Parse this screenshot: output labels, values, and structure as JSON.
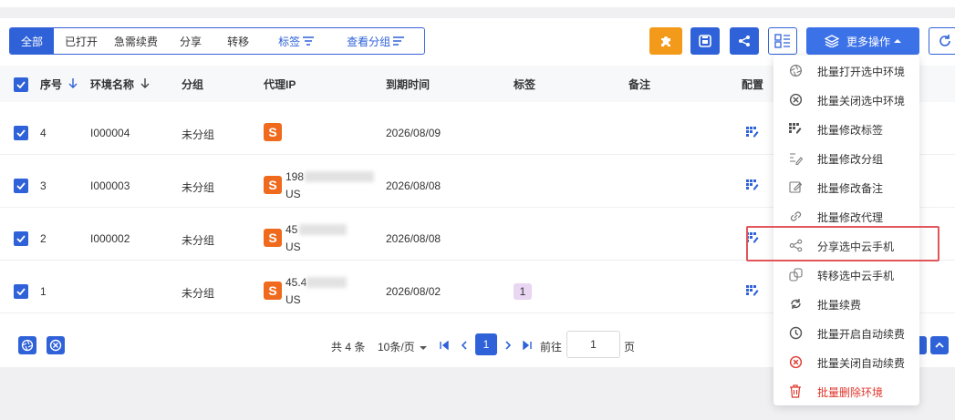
{
  "tabs": [
    {
      "label": "全部",
      "active": true
    },
    {
      "label": "已打开"
    },
    {
      "label": "急需续费"
    },
    {
      "label": "分享"
    },
    {
      "label": "转移"
    },
    {
      "label": "标签"
    },
    {
      "label": "查看分组"
    }
  ],
  "toolbar": {
    "more_label": "更多操作",
    "buttons": [
      "puzzle-icon",
      "save-icon",
      "share-icon",
      "layout-icon",
      "refresh-icon"
    ]
  },
  "table": {
    "columns": [
      "序号",
      "环境名称",
      "分组",
      "代理IP",
      "到期时间",
      "标签",
      "备注",
      "配置"
    ],
    "rows": [
      {
        "seq": "4",
        "name": "I000004",
        "group": "未分组",
        "proxy_line1": "",
        "proxy_line2": "",
        "expiry": "2026/08/09",
        "tag": ""
      },
      {
        "seq": "3",
        "name": "I000003",
        "group": "未分组",
        "proxy_line1": "198",
        "proxy_line2": "US",
        "expiry": "2026/08/08",
        "tag": ""
      },
      {
        "seq": "2",
        "name": "I000002",
        "group": "未分组",
        "proxy_line1": "45",
        "proxy_line2": "US",
        "expiry": "2026/08/08",
        "tag": ""
      },
      {
        "seq": "1",
        "name": "",
        "group": "未分组",
        "proxy_line1": "45.4",
        "proxy_line2": "US",
        "expiry": "2026/08/02",
        "tag": "1"
      }
    ]
  },
  "pagination": {
    "total": "共 4 条",
    "page_size": "10条/页",
    "current_page": "1",
    "goto_label": "前往",
    "goto_value": "1",
    "page_suffix": "页"
  },
  "dropdown": {
    "items": [
      {
        "label": "批量打开选中环境",
        "icon": "aperture-icon"
      },
      {
        "label": "批量关闭选中环境",
        "icon": "close-circle-icon"
      },
      {
        "label": "批量修改标签",
        "icon": "tag-grid-icon"
      },
      {
        "label": "批量修改分组",
        "icon": "group-edit-icon"
      },
      {
        "label": "批量修改备注",
        "icon": "note-edit-icon"
      },
      {
        "label": "批量修改代理",
        "icon": "link-icon"
      },
      {
        "label": "分享选中云手机",
        "icon": "share-icon"
      },
      {
        "label": "转移选中云手机",
        "icon": "transfer-icon"
      },
      {
        "label": "批量续费",
        "icon": "renew-icon"
      },
      {
        "label": "批量开启自动续费",
        "icon": "clock-icon"
      },
      {
        "label": "批量关闭自动续费",
        "icon": "cancel-circle-icon"
      },
      {
        "label": "批量删除环境",
        "icon": "trash-icon"
      }
    ]
  },
  "colors": {
    "primary": "#2f62d8",
    "orange": "#f39a1a",
    "proxy_badge": "#f06a1e",
    "danger": "#e0362c",
    "highlight_box": "#e0565b"
  }
}
